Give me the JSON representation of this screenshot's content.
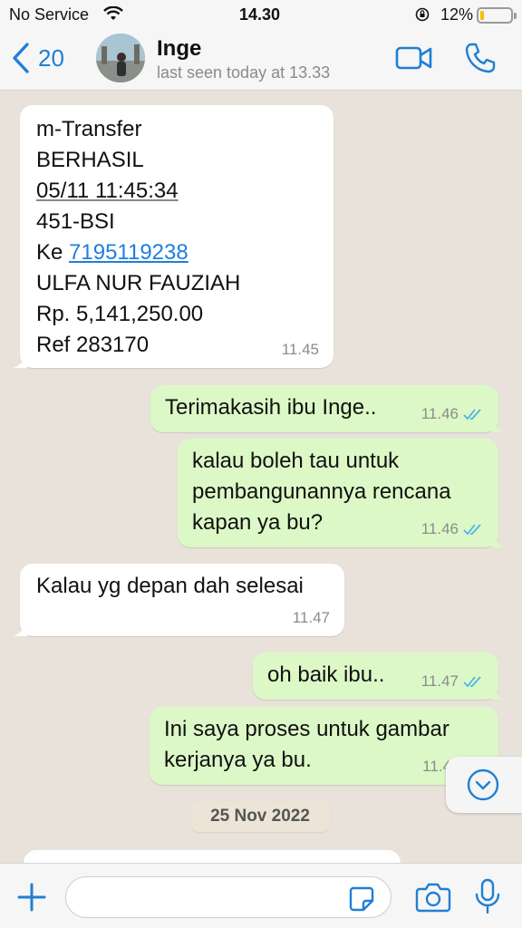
{
  "status_bar": {
    "carrier": "No Service",
    "time": "14.30",
    "battery_percent": "12%",
    "battery_level": 0.12
  },
  "header": {
    "back_count": "20",
    "contact_name": "Inge",
    "contact_status": "last seen today at 13.33"
  },
  "messages": [
    {
      "direction": "in",
      "lines": [
        "m-Transfer",
        "BERHASIL",
        "05/11 11:45:34",
        "451-BSI",
        "Ke ",
        "ULFA NUR FAUZIAH",
        "Rp. 5,141,250.00",
        "Ref 283170"
      ],
      "link": "7195119238",
      "time": "11.45"
    },
    {
      "direction": "out",
      "lines": [
        "Terimakasih ibu Inge.."
      ],
      "time": "11.46",
      "read": true
    },
    {
      "direction": "out",
      "lines": [
        "kalau boleh tau untuk",
        "pembangunannya rencana",
        "kapan ya bu?"
      ],
      "time": "11.46",
      "read": true
    },
    {
      "direction": "in",
      "lines": [
        "Kalau yg depan dah selesai"
      ],
      "time": "11.47"
    },
    {
      "direction": "out",
      "lines": [
        "oh baik ibu.."
      ],
      "time": "11.47",
      "read": true
    },
    {
      "direction": "out",
      "lines": [
        "Ini saya proses untuk gambar",
        "kerjanya ya bu."
      ],
      "time": "11.4"
    }
  ],
  "date_chip": "25 Nov 2022",
  "icons": {
    "wifi": "wifi-icon",
    "orientation_lock": "orientation-lock-icon",
    "battery": "battery-icon",
    "back": "chevron-left-icon",
    "video": "video-camera-icon",
    "call": "phone-icon",
    "scroll_down": "chevron-down-circle-icon",
    "plus": "plus-icon",
    "sticker": "sticker-icon",
    "camera": "camera-icon",
    "mic": "microphone-icon",
    "read_receipt": "double-check-icon"
  },
  "colors": {
    "accent": "#1f7fd4",
    "incoming_bubble": "#ffffff",
    "outgoing_bubble": "#dcf8c6",
    "read_tick": "#4fb3e8",
    "battery_low": "#f0c500"
  }
}
